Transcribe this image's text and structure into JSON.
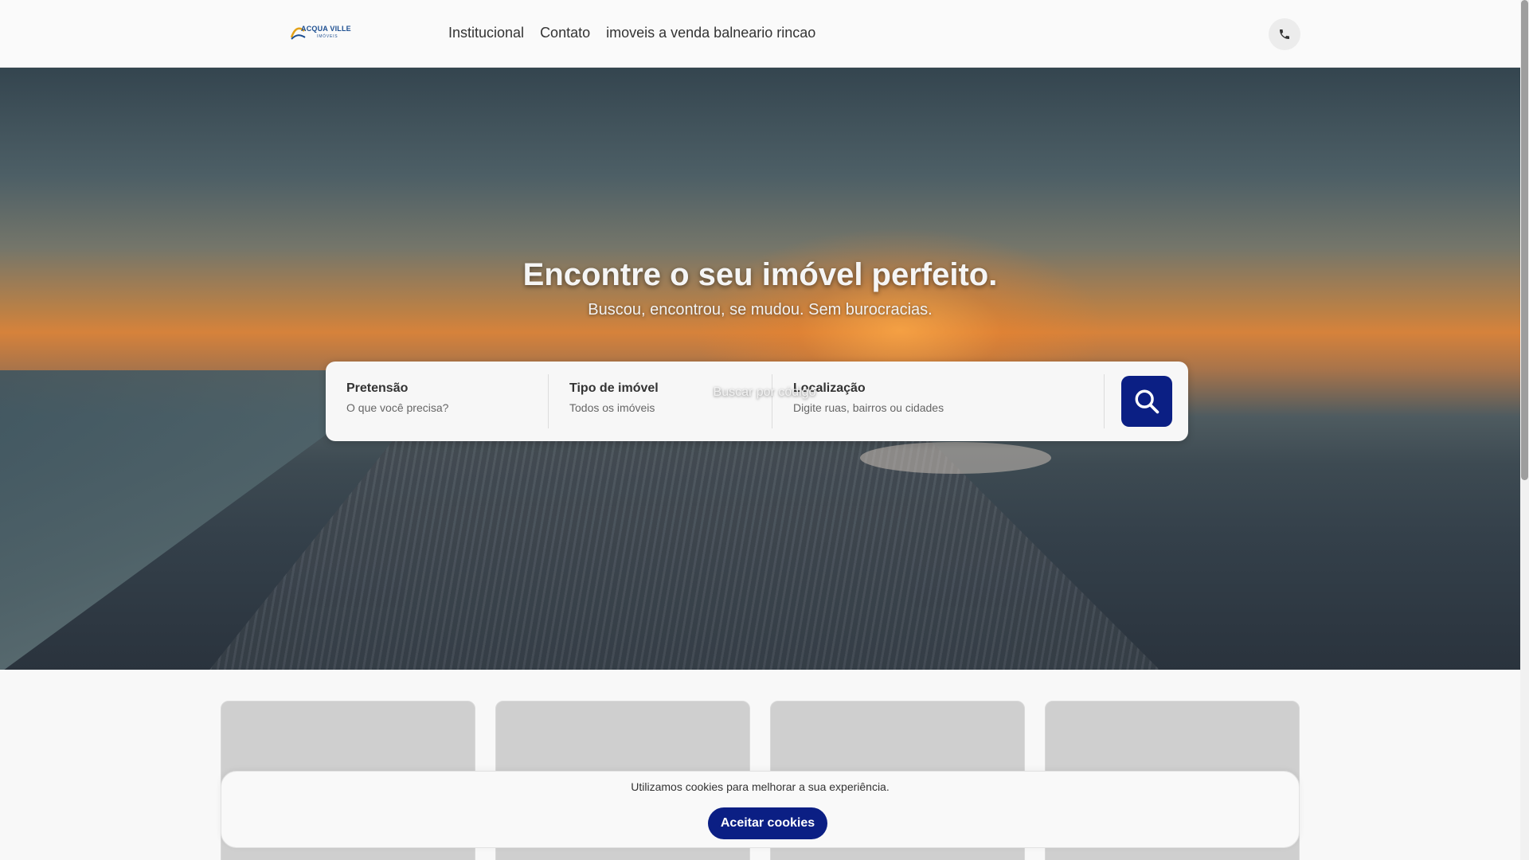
{
  "header": {
    "logo_text": "ACQUA VILLE",
    "logo_sub": "IMÓVEIS",
    "nav": [
      {
        "label": "Institucional"
      },
      {
        "label": "Contato"
      },
      {
        "label": "imoveis a venda balneario rincao"
      }
    ],
    "phone_icon": "phone-icon"
  },
  "hero": {
    "title": "Encontre o seu imóvel perfeito.",
    "subtitle": "Buscou, encontrou, se mudou. Sem burocracias."
  },
  "search": {
    "fields": [
      {
        "label": "Pretensão",
        "value": "O que você precisa?"
      },
      {
        "label": "Tipo de imóvel",
        "value": "Todos os imóveis"
      },
      {
        "label": "Localização",
        "value": "Digite ruas, bairros ou cidades"
      }
    ],
    "button_icon": "search-icon",
    "code_link": "Buscar por código"
  },
  "cookie": {
    "text": "Utilizamos cookies para melhorar a sua experiência.",
    "button": "Aceitar cookies"
  },
  "colors": {
    "accent": "#0b1f84",
    "header_bg": "#fafafa"
  }
}
